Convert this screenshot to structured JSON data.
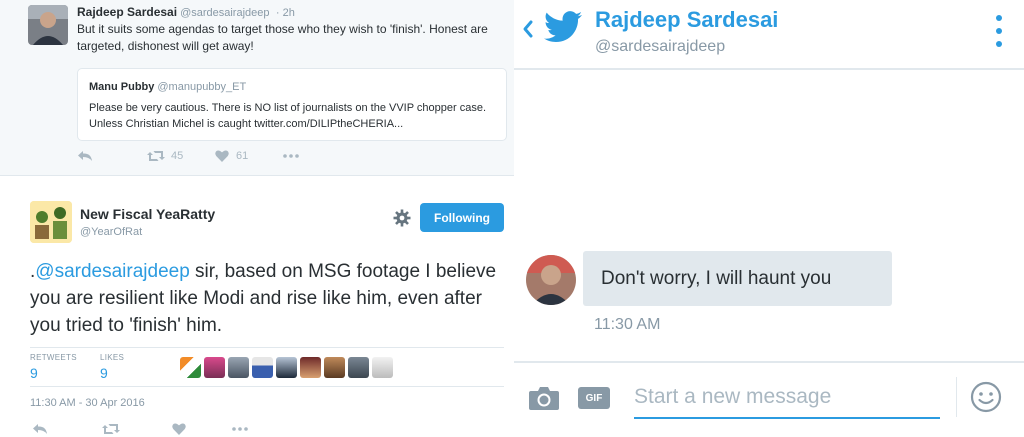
{
  "reply_tweet": {
    "author_name": "Rajdeep Sardesai",
    "author_handle": "@sardesairajdeep",
    "time": "· 2h",
    "text": "But it suits some agendas to target those who they wish to 'finish'. Honest are targeted, dishonest will get away!",
    "quoted": {
      "author_name": "Manu Pubby",
      "author_handle": "@manupubby_ET",
      "text": "Please be very cautious. There is NO list of journalists on the VVIP chopper case. Unless Christian Michel is caught twitter.com/DILIPtheCHERIA..."
    },
    "retweet_count": "45",
    "like_count": "61"
  },
  "main_tweet": {
    "author_name": "New Fiscal YeaRatty",
    "author_handle": "@YearOfRat",
    "follow_label": "Following",
    "text_prefix": ".",
    "mention": "@sardesairajdeep",
    "text_rest": " sir, based on MSG footage I believe you are resilient like Modi and rise like him, even after you tried to 'finish' him.",
    "retweets_label": "RETWEETS",
    "retweets_count": "9",
    "likes_label": "LIKES",
    "likes_count": "9",
    "timestamp": "11:30 AM - 30 Apr 2016"
  },
  "dm": {
    "header_name": "Rajdeep Sardesai",
    "header_handle": "@sardesairajdeep",
    "message_text": "Don't worry, I will haunt you",
    "message_time": "11:30 AM",
    "compose_placeholder": "Start a new message",
    "gif_label": "GIF"
  },
  "colors": {
    "twitter_blue": "#2b9be0",
    "muted_gray": "#8899a6",
    "bubble_bg": "#e1e8ed"
  }
}
